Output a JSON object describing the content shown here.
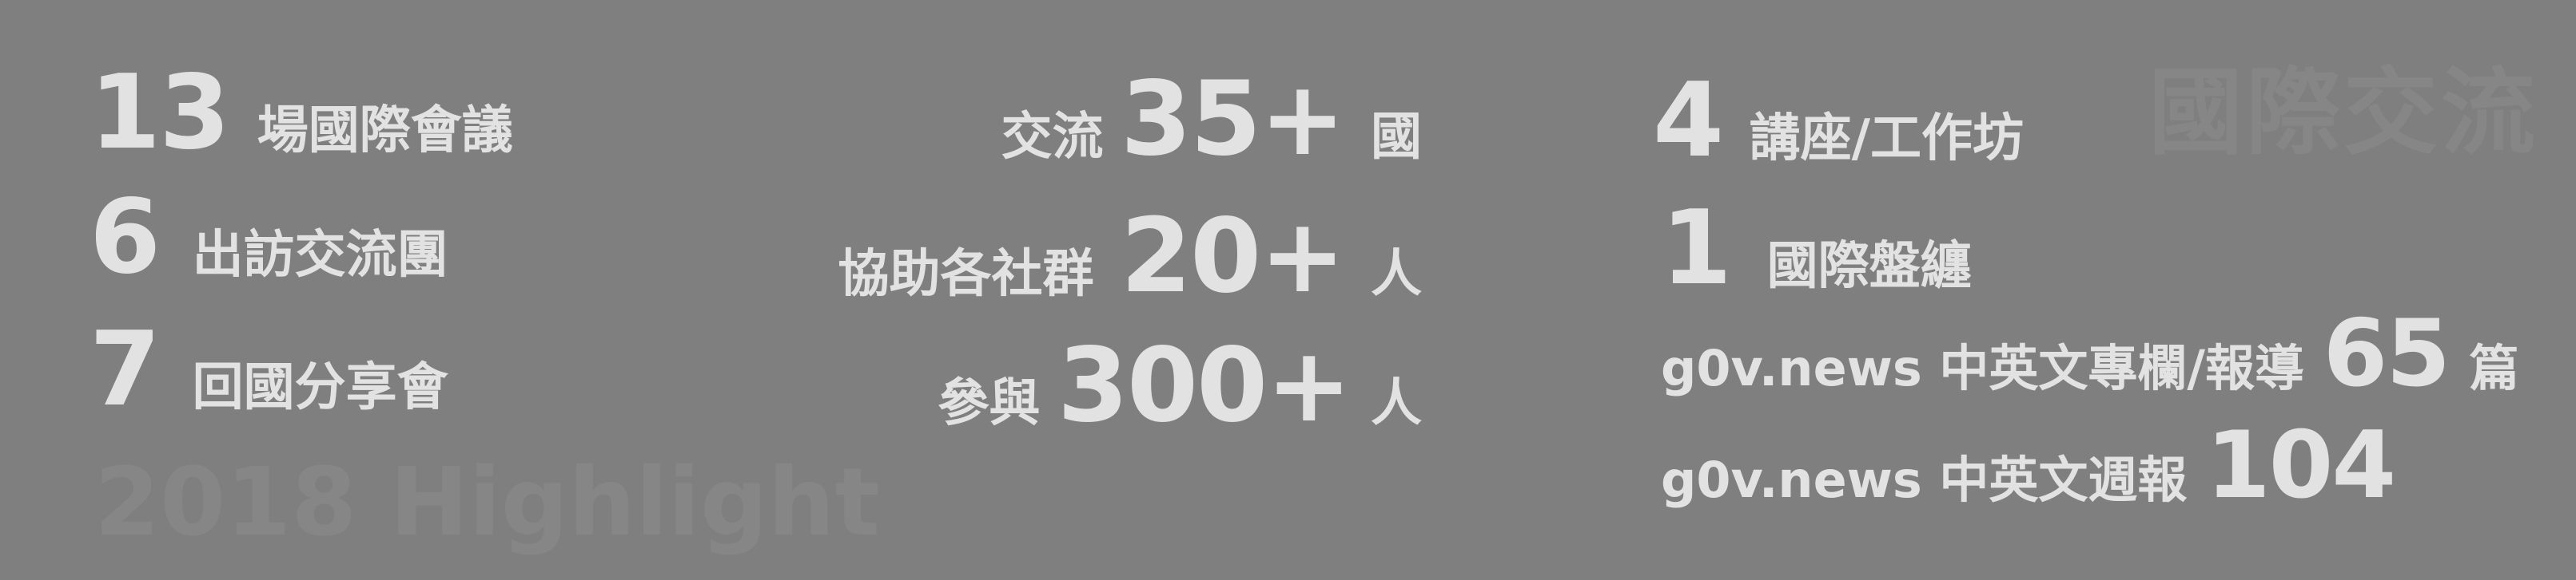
{
  "header": {
    "ghost_title": "國際交流",
    "ghost_year": "2018 Highlight"
  },
  "col1": [
    {
      "value": "13",
      "label": "場國際會議"
    },
    {
      "value": "6",
      "label": "出訪交流團"
    },
    {
      "value": "7",
      "label": "回國分享會"
    }
  ],
  "col2": [
    {
      "prefix": "交流",
      "value": "35+",
      "suffix": "國"
    },
    {
      "prefix": "協助各社群",
      "value": "20+",
      "suffix": "人"
    },
    {
      "prefix": "參與",
      "value": "300+",
      "suffix": "人"
    }
  ],
  "col3": [
    {
      "value": "4",
      "label": "講座/工作坊"
    },
    {
      "value": "1",
      "label": "國際盤纏"
    },
    {
      "prefix": "g0v.news 中英文專欄/報導",
      "value": "65",
      "suffix": "篇"
    },
    {
      "prefix": "g0v.news 中英文週報",
      "value": "104"
    }
  ]
}
